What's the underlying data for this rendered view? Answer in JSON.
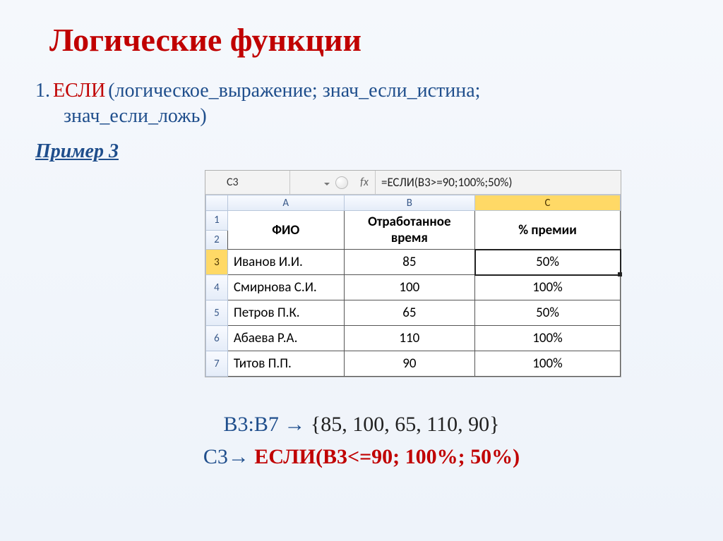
{
  "title": "Логические функции",
  "item_number": "1.",
  "func_name": "ЕСЛИ",
  "func_args_line1": " (логическое_выражение; знач_если_истина;",
  "func_args_line2": "знач_если_ложь)",
  "example_label": "Пример 3",
  "excel": {
    "active_cell": "C3",
    "fx_label": "fx",
    "formula": "=ЕСЛИ(B3>=90;100%;50%)",
    "columns": [
      "A",
      "B",
      "C"
    ],
    "header_row": {
      "a": "ФИО",
      "b": "Отработанное время",
      "c": "% премии"
    },
    "rows": [
      {
        "n": "3",
        "a": "Иванов И.И.",
        "b": "85",
        "c": "50%"
      },
      {
        "n": "4",
        "a": "Смирнова С.И.",
        "b": "100",
        "c": "100%"
      },
      {
        "n": "5",
        "a": "Петров П.К.",
        "b": "65",
        "c": "50%"
      },
      {
        "n": "6",
        "a": "Абаева Р.А.",
        "b": "110",
        "c": "100%"
      },
      {
        "n": "7",
        "a": "Титов П.П.",
        "b": "90",
        "c": "100%"
      }
    ]
  },
  "bottom": {
    "range": "B3:B7",
    "arrow": "→",
    "set": "{85, 100, 65, 110, 90}",
    "cell": "C3",
    "formula": "ЕСЛИ(B3<=90; 100%; 50%)"
  },
  "chart_data": {
    "type": "table",
    "title": "Логические функции — Пример 3",
    "columns": [
      "ФИО",
      "Отработанное время",
      "% премии"
    ],
    "rows": [
      [
        "Иванов И.И.",
        85,
        "50%"
      ],
      [
        "Смирнова С.И.",
        100,
        "100%"
      ],
      [
        "Петров П.К.",
        65,
        "50%"
      ],
      [
        "Абаева Р.А.",
        110,
        "100%"
      ],
      [
        "Титов П.П.",
        90,
        "100%"
      ]
    ]
  }
}
